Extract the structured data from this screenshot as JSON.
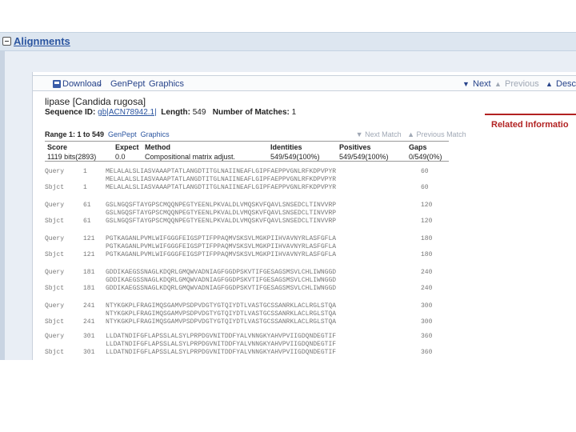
{
  "section": {
    "title": "Alignments"
  },
  "toolbar": {
    "download": "Download",
    "genpept": "GenPept",
    "graphics": "Graphics",
    "next": "Next",
    "previous": "Previous",
    "descriptions": "Desc"
  },
  "hit": {
    "title": "lipase [Candida rugosa]",
    "seqid_label": "Sequence ID:",
    "seqid_value": "gb|ACN78942.1|",
    "length_label": "Length:",
    "length_value": "549",
    "matches_label": "Number of Matches:",
    "matches_value": "1"
  },
  "related": "Related Informatio",
  "range": {
    "label": "Range 1: 1 to 549",
    "genpept": "GenPept",
    "graphics": "Graphics",
    "next_match": "Next Match",
    "prev_match": "Previous Match"
  },
  "stats": {
    "headers": [
      "Score",
      "Expect",
      "Method",
      "Identities",
      "Positives",
      "Gaps"
    ],
    "values": [
      "1119 bits(2893)",
      "0.0",
      "Compositional matrix adjust.",
      "549/549(100%)",
      "549/549(100%)",
      "0/549(0%)"
    ]
  },
  "alignment": [
    {
      "query_label": "Query",
      "query_start": "1",
      "query_seq": "MELALALSLIASVAAAPTATLANGDTITGLNAIINEAFLGIPFAEPPVGNLRFKDPVPYR",
      "query_end": "60",
      "mid": "MELALALSLIASVAAAPTATLANGDTITGLNAIINEAFLGIPFAEPPVGNLRFKDPVPYR",
      "sbjct_label": "Sbjct",
      "sbjct_start": "1",
      "sbjct_seq": "MELALALSLIASVAAAPTATLANGDTITGLNAIINEAFLGIPFAEPPVGNLRFKDPVPYR",
      "sbjct_end": "60"
    },
    {
      "query_label": "Query",
      "query_start": "61",
      "query_seq": "GSLNGQSFTAYGPSCMQQNPEGTYEENLPKVALDLVMQSKVFQAVLSNSEDCLTINVVRP",
      "query_end": "120",
      "mid": "GSLNGQSFTAYGPSCMQQNPEGTYEENLPKVALDLVMQSKVFQAVLSNSEDCLTINVVRP",
      "sbjct_label": "Sbjct",
      "sbjct_start": "61",
      "sbjct_seq": "GSLNGQSFTAYGPSCMQQNPEGTYEENLPKVALDLVMQSKVFQAVLSNSEDCLTINVVRP",
      "sbjct_end": "120"
    },
    {
      "query_label": "Query",
      "query_start": "121",
      "query_seq": "PGTKAGANLPVMLWIFGGGFEIGSPTIFPPAQMVSKSVLMGKPIIHVAVNYRLASFGFLA",
      "query_end": "180",
      "mid": "PGTKAGANLPVMLWIFGGGFEIGSPTIFPPAQMVSKSVLMGKPIIHVAVNYRLASFGFLA",
      "sbjct_label": "Sbjct",
      "sbjct_start": "121",
      "sbjct_seq": "PGTKAGANLPVMLWIFGGGFEIGSPTIFPPAQMVSKSVLMGKPIIHVAVNYRLASFGFLA",
      "sbjct_end": "180"
    },
    {
      "query_label": "Query",
      "query_start": "181",
      "query_seq": "GDDIKAEGSSNAGLKDQRLGMQWVADNIAGFGGDPSKVTIFGESAGSMSVLCHLIWNGGD",
      "query_end": "240",
      "mid": "GDDIKAEGSSNAGLKDQRLGMQWVADNIAGFGGDPSKVTIFGESAGSMSVLCHLIWNGGD",
      "sbjct_label": "Sbjct",
      "sbjct_start": "181",
      "sbjct_seq": "GDDIKAEGSSNAGLKDQRLGMQWVADNIAGFGGDPSKVTIFGESAGSMSVLCHLIWNGGD",
      "sbjct_end": "240"
    },
    {
      "query_label": "Query",
      "query_start": "241",
      "query_seq": "NTYKGKPLFRAGIMQSGAMVPSDPVDGTYGTQIYDTLVASTGCSSANRKLACLRGLSTQA",
      "query_end": "300",
      "mid": "NTYKGKPLFRAGIMQSGAMVPSDPVDGTYGTQIYDTLVASTGCSSANRKLACLRGLSTQA",
      "sbjct_label": "Sbjct",
      "sbjct_start": "241",
      "sbjct_seq": "NTYKGKPLFRAGIMQSGAMVPSDPVDGTYGTQIYDTLVASTGCSSANRKLACLRGLSTQA",
      "sbjct_end": "300"
    },
    {
      "query_label": "Query",
      "query_start": "301",
      "query_seq": "LLDATNDIFGFLAPSSLALSYLPRPDGVNITDDFYALVNNGKYAHVPVIIGDQNDEGTIF",
      "query_end": "360",
      "mid": "LLDATNDIFGFLAPSSLALSYLPRPDGVNITDDFYALVNNGKYAHVPVIIGDQNDEGTIF",
      "sbjct_label": "Sbjct",
      "sbjct_start": "301",
      "sbjct_seq": "LLDATNDIFGFLAPSSLALSYLPRPDGVNITDDFYALVNNGKYAHVPVIIGDQNDEGTIF",
      "sbjct_end": "360"
    }
  ]
}
